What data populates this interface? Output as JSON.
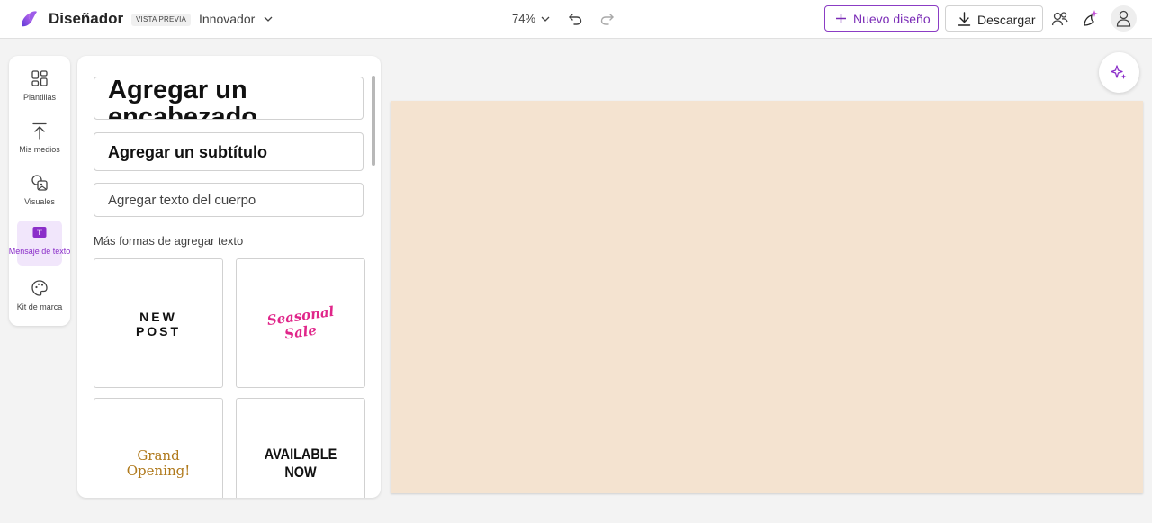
{
  "header": {
    "app_name": "Diseñador",
    "preview_badge": "VISTA PREVIA",
    "project_name": "Innovador",
    "zoom": "74%",
    "new_design_label": "Nuevo diseño",
    "download_label": "Descargar"
  },
  "sidebar": {
    "items": [
      {
        "label": "Plantillas",
        "icon": "templates-icon"
      },
      {
        "label": "Mis medios",
        "icon": "upload-icon"
      },
      {
        "label": "Visuales",
        "icon": "visuals-icon"
      },
      {
        "label": "Mensaje de texto",
        "icon": "text-icon",
        "active": true
      },
      {
        "label": "Kit de marca",
        "icon": "palette-icon"
      }
    ]
  },
  "text_panel": {
    "heading_label": "Agregar un encabezado",
    "subtitle_label": "Agregar un subtítulo",
    "body_label": "Agregar texto del cuerpo",
    "more_ways_title": "Más formas de agregar texto",
    "samples": [
      {
        "lines": [
          "NEW",
          "POST"
        ]
      },
      {
        "lines": [
          "Seasonal",
          "Sale"
        ]
      },
      {
        "lines": [
          "Grand",
          "Opening!"
        ]
      },
      {
        "lines": [
          "AVAILABLE",
          "NOW"
        ]
      }
    ]
  },
  "canvas": {
    "background_color": "#f4e3d0"
  },
  "colors": {
    "accent": "#8b3cc4",
    "canvas": "#f4e3d0"
  }
}
